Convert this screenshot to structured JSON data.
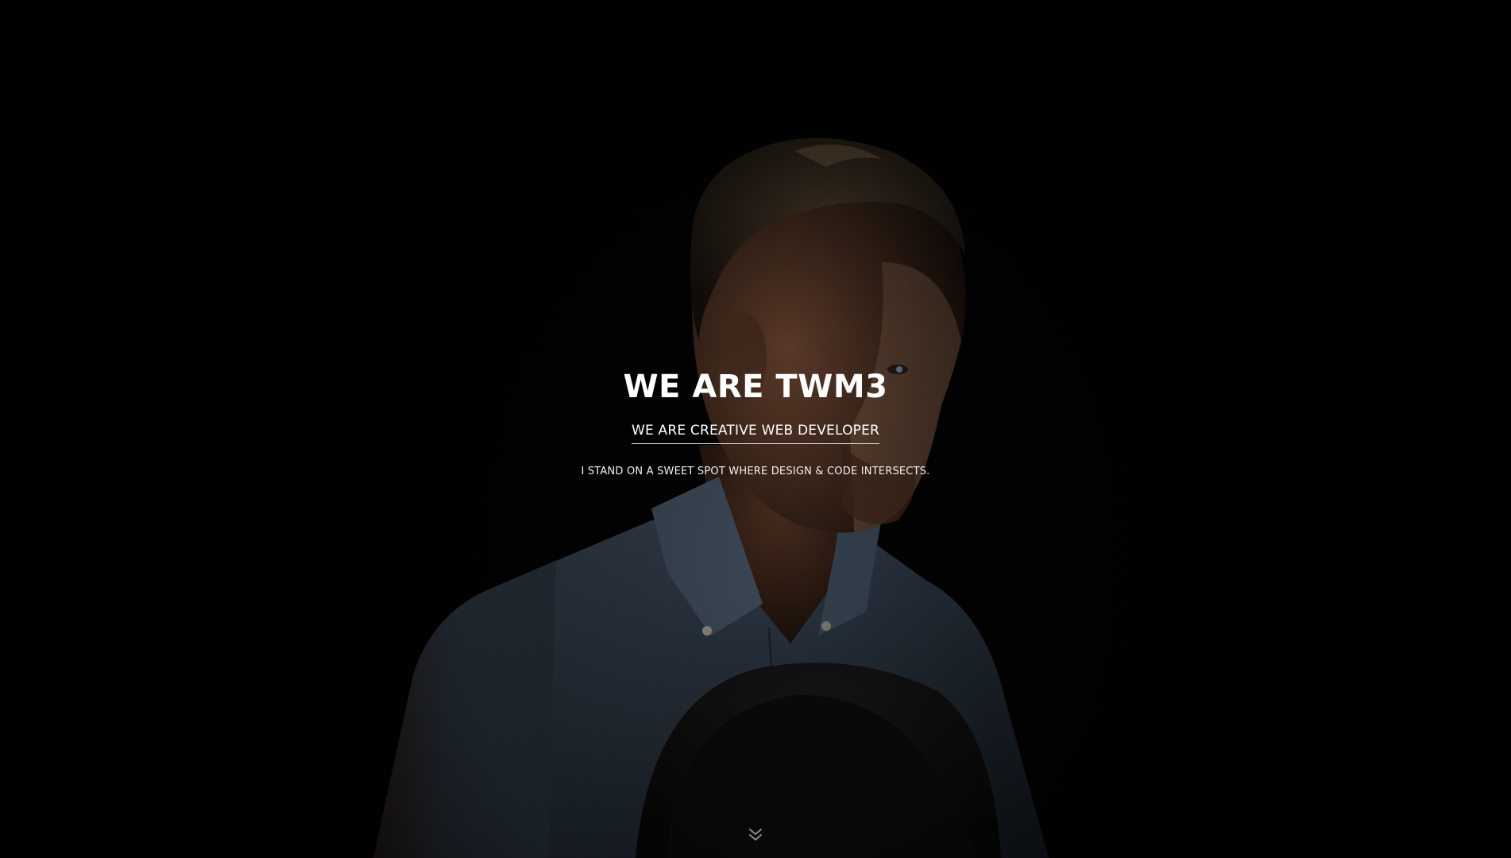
{
  "hero": {
    "title": "WE ARE TWM3",
    "subtitle": "WE ARE CREATIVE WEB DEVELOPER",
    "tagline": "I STAND ON A SWEET SPOT WHERE DESIGN & CODE INTERSECTS.",
    "scroll_icon": "double-chevron-down-icon",
    "background_image": "portrait of a man in a denim shirt holding a dark hat, low-key lighting"
  },
  "colors": {
    "background": "#020202",
    "text": "#ffffff",
    "underline": "#e8e8e8",
    "scroll_icon": "#8a8a8a"
  }
}
